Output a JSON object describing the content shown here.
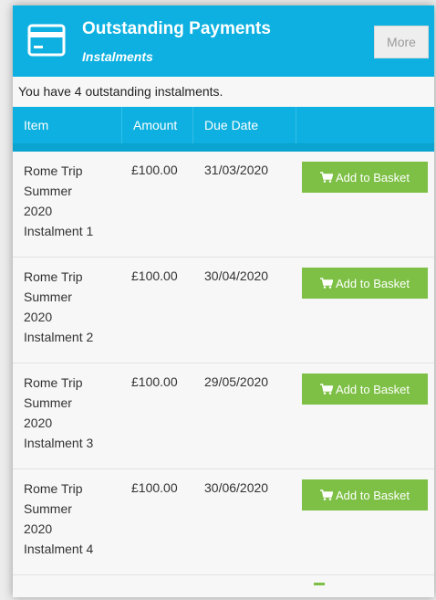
{
  "header": {
    "title": "Outstanding Payments",
    "subtitle": "Instalments",
    "more_label": "More",
    "icon": "credit-card-icon"
  },
  "summary": {
    "prefix": "You have",
    "count": "4",
    "suffix": "outstanding instalments."
  },
  "table": {
    "columns": [
      "Item",
      "Amount",
      "Due Date",
      ""
    ],
    "rows": [
      {
        "item_lines": [
          "Rome Trip",
          "Summer",
          "2020",
          "Instalment 1"
        ],
        "amount": "£100.00",
        "due_date": "31/03/2020",
        "action_label": "Add to Basket"
      },
      {
        "item_lines": [
          "Rome Trip",
          "Summer",
          "2020",
          "Instalment 2"
        ],
        "amount": "£100.00",
        "due_date": "30/04/2020",
        "action_label": "Add to Basket"
      },
      {
        "item_lines": [
          "Rome Trip",
          "Summer",
          "2020",
          "Instalment 3"
        ],
        "amount": "£100.00",
        "due_date": "29/05/2020",
        "action_label": "Add to Basket"
      },
      {
        "item_lines": [
          "Rome Trip",
          "Summer",
          "2020",
          "Instalment 4"
        ],
        "amount": "£100.00",
        "due_date": "30/06/2020",
        "action_label": "Add to Basket"
      }
    ]
  },
  "colors": {
    "header_bg": "#0db0e0",
    "button_green": "#7dc045"
  }
}
